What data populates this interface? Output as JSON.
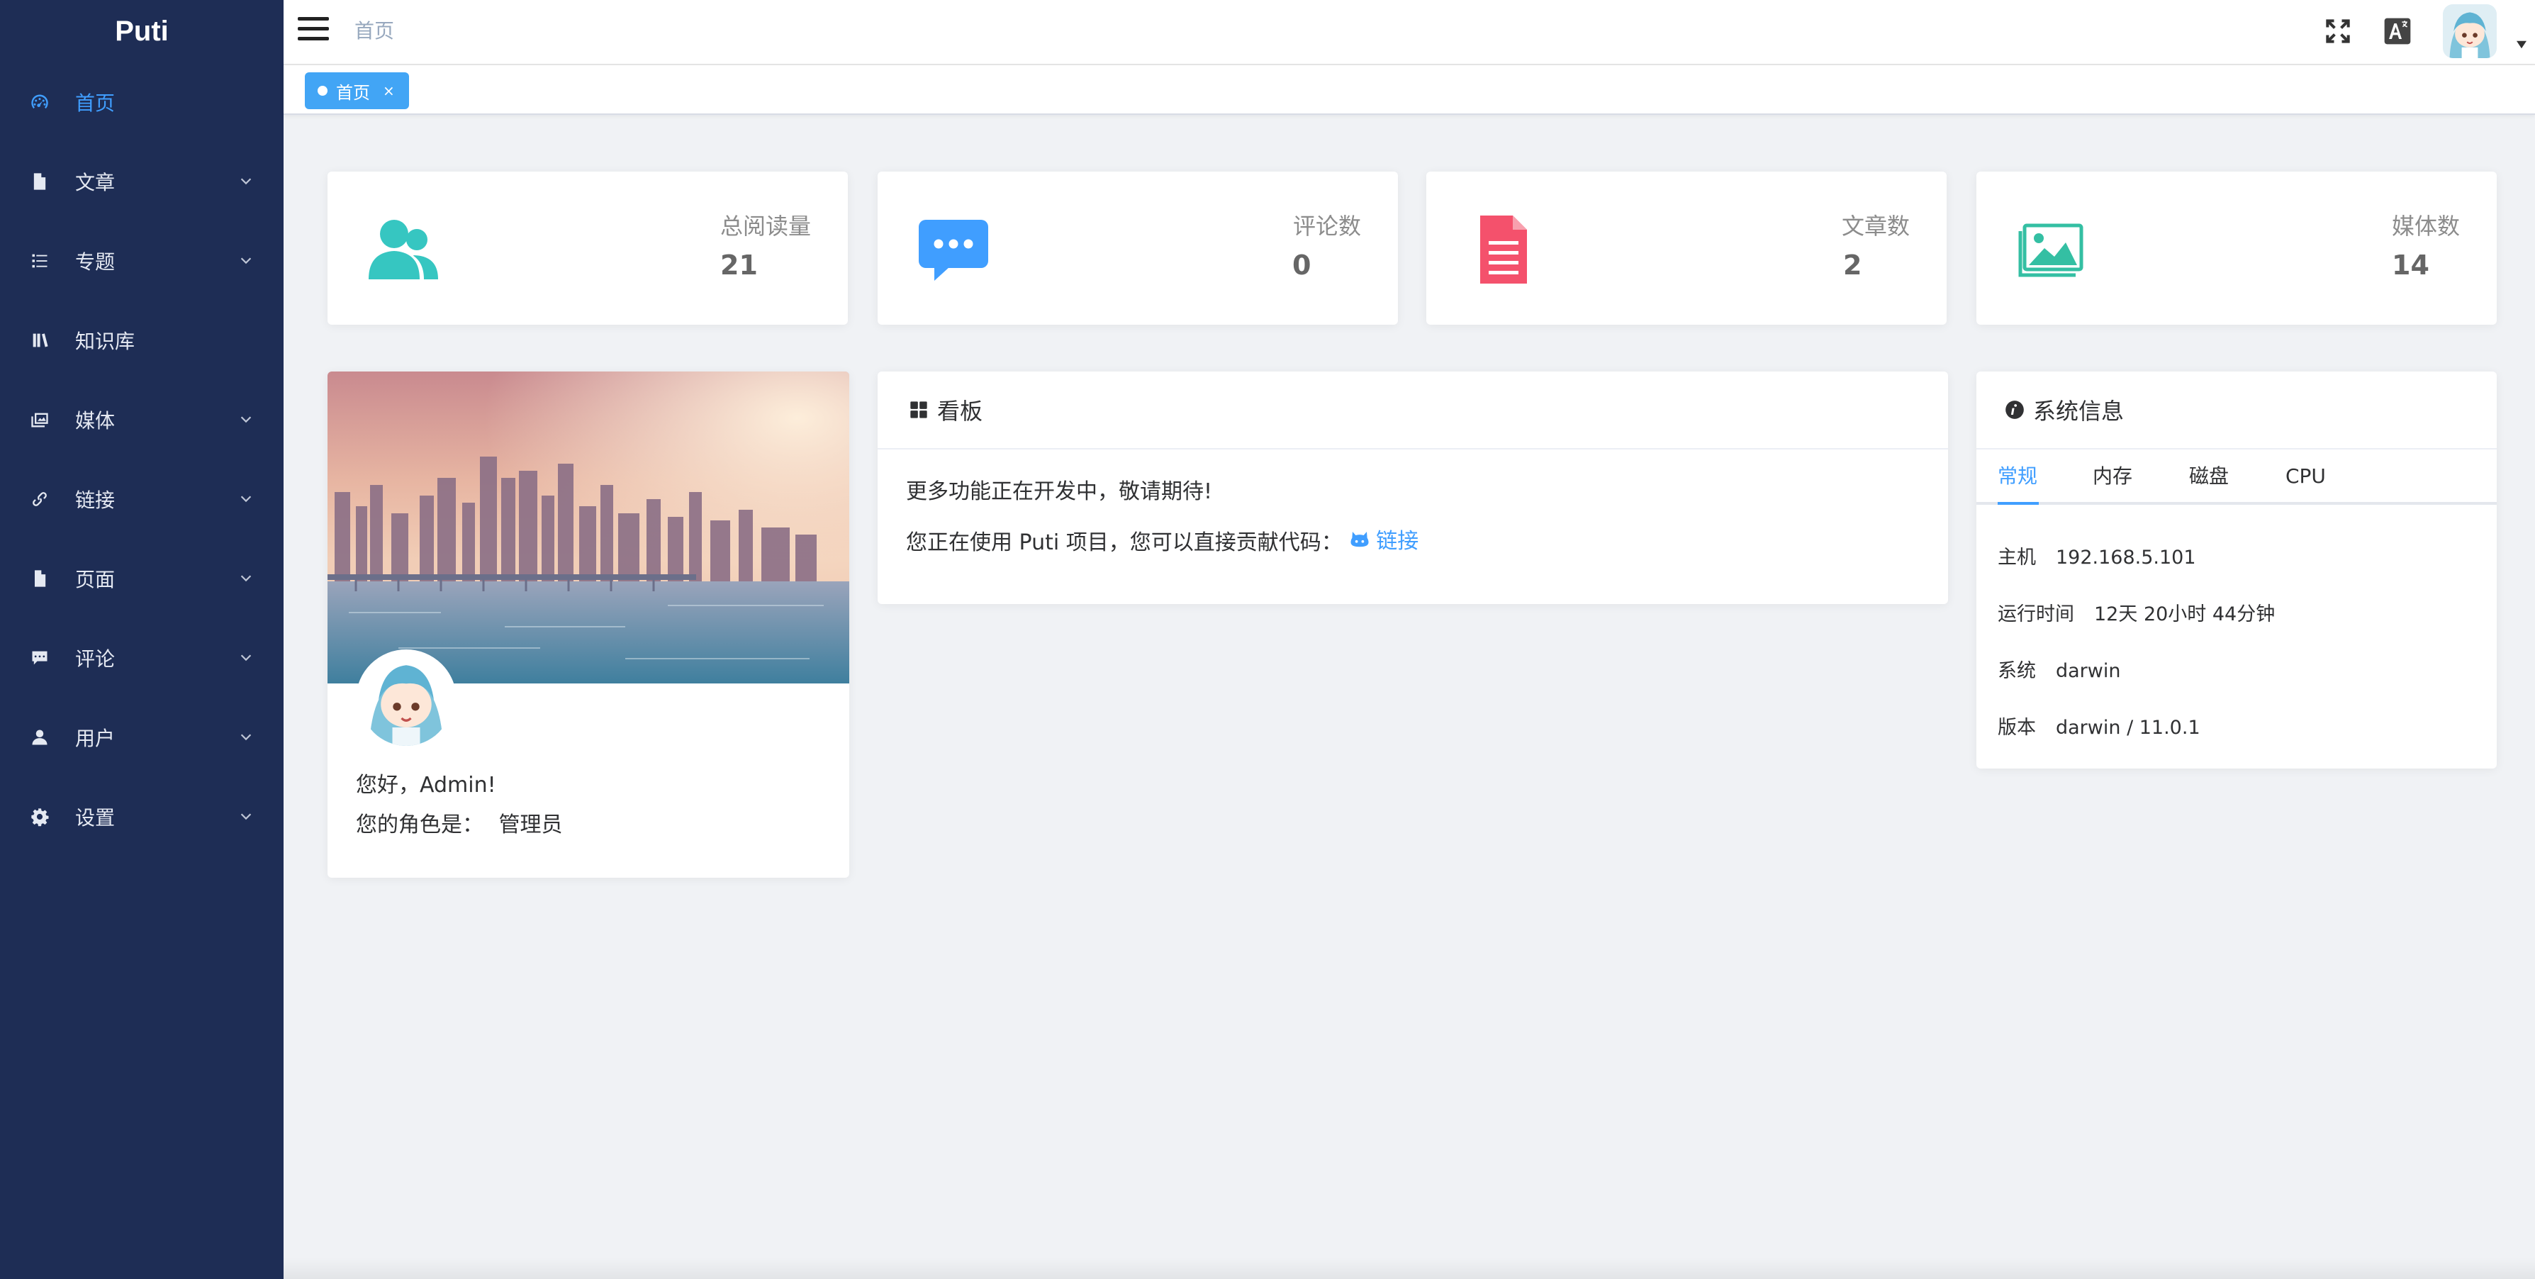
{
  "sidebar": {
    "brand": "Puti",
    "items": [
      {
        "label": "首页",
        "icon": "dashboard-icon",
        "active": true
      },
      {
        "label": "文章",
        "icon": "document-icon",
        "expandable": true
      },
      {
        "label": "专题",
        "icon": "list-icon",
        "expandable": true
      },
      {
        "label": "知识库",
        "icon": "books-icon"
      },
      {
        "label": "媒体",
        "icon": "photos-icon",
        "expandable": true
      },
      {
        "label": "链接",
        "icon": "link-icon",
        "expandable": true
      },
      {
        "label": "页面",
        "icon": "file-icon",
        "expandable": true
      },
      {
        "label": "评论",
        "icon": "comment-icon",
        "expandable": true
      },
      {
        "label": "用户",
        "icon": "user-icon",
        "expandable": true
      },
      {
        "label": "设置",
        "icon": "gear-icon",
        "expandable": true
      }
    ]
  },
  "header": {
    "breadcrumb": "首页",
    "icons": [
      "fullscreen-icon",
      "translate-icon",
      "user-avatar"
    ]
  },
  "tags": [
    {
      "label": "首页",
      "active": true,
      "close": "×"
    }
  ],
  "stats": [
    {
      "label": "总阅读量",
      "value": "21",
      "icon": "users-icon",
      "color": "#36c6c1"
    },
    {
      "label": "评论数",
      "value": "0",
      "icon": "chat-icon",
      "color": "#409eff"
    },
    {
      "label": "文章数",
      "value": "2",
      "icon": "article-icon",
      "color": "#f4516c"
    },
    {
      "label": "媒体数",
      "value": "14",
      "icon": "picture-icon",
      "color": "#34bfa3"
    }
  ],
  "profile": {
    "greeting": "您好，Admin!",
    "role_label": "您的角色是：",
    "role": "管理员"
  },
  "board": {
    "title": "看板",
    "line1": "更多功能正在开发中，敬请期待!",
    "line2": "您正在使用 Puti 项目，您可以直接贡献代码：",
    "link_label": "链接"
  },
  "sysinfo": {
    "title": "系统信息",
    "tabs": [
      "常规",
      "内存",
      "磁盘",
      "CPU"
    ],
    "active_tab": "常规",
    "rows": [
      {
        "key": "主机",
        "value": "192.168.5.101"
      },
      {
        "key": "运行时间",
        "value": "12天 20小时 44分钟"
      },
      {
        "key": "系统",
        "value": "darwin"
      },
      {
        "key": "版本",
        "value": "darwin / 11.0.1"
      }
    ]
  },
  "colors": {
    "sidebar_bg": "#1e2d55",
    "accent": "#409eff",
    "page_bg": "#f0f2f5"
  }
}
